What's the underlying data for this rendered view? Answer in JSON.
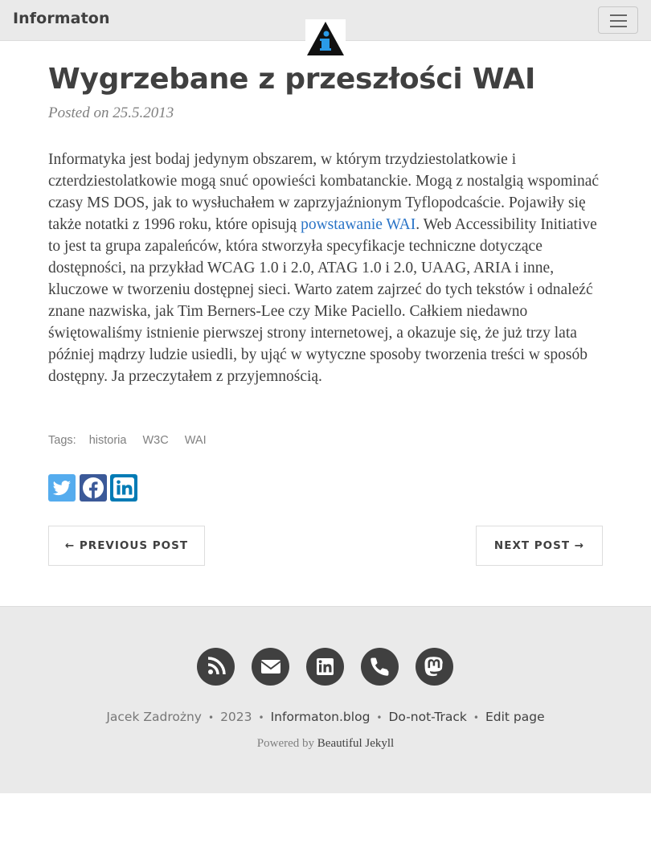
{
  "nav": {
    "brand": "Informaton",
    "logo_icon": "info-triangle-logo",
    "menu_icon": "hamburger-menu-icon"
  },
  "post": {
    "title": "Wygrzebane z przeszłości WAI",
    "meta": "Posted on 25.5.2013",
    "body_before_link": "Informatyka jest bodaj jedynym obszarem, w którym trzydziestolatkowie i czterdziestolatkowie mogą snuć opowieści kombatanckie. Mogą z nostalgią wspominać czasy MS DOS, jak to wysłuchałem w zaprzyjaźnionym Tyflopodcaście. Pojawiły się także notatki z 1996 roku, które opisują ",
    "link_text": "powstawanie WAI",
    "body_after_link": ". Web Accessibility Initiative to jest ta grupa zapaleńców, która stworzyła specyfikacje techniczne dotyczące dostępności, na przykład WCAG 1.0 i 2.0, ATAG 1.0 i 2.0, UAAG, ARIA i inne, kluczowe w tworzeniu dostępnej sieci. Warto zatem zajrzeć do tych tekstów i odnaleźć znane nazwiska, jak Tim Berners-Lee czy Mike Paciello. Całkiem niedawno świętowaliśmy istnienie pierwszej strony internetowej, a okazuje się, że już trzy lata później mądrzy ludzie usiedli, by ująć w wytyczne sposoby tworzenia treści w sposób dostępny. Ja przeczytałem z przyjemnością.",
    "link_color": "#2a74c7"
  },
  "tags": {
    "label": "Tags:",
    "items": [
      "historia",
      "W3C",
      "WAI"
    ]
  },
  "share": [
    {
      "name": "twitter",
      "icon": "twitter-icon",
      "color": "#55acee"
    },
    {
      "name": "facebook",
      "icon": "facebook-icon",
      "color": "#3b5998"
    },
    {
      "name": "linkedin",
      "icon": "linkedin-icon",
      "color": "#007bb5"
    }
  ],
  "pager": {
    "previous": "← PREVIOUS POST",
    "next": "NEXT POST →"
  },
  "footer": {
    "social_icons": [
      "rss-icon",
      "envelope-icon",
      "linkedin-icon",
      "phone-icon",
      "mastodon-icon"
    ],
    "author": "Jacek Zadrożny",
    "year": "2023",
    "site": "Informaton.blog",
    "dnt": "Do-not-Track",
    "edit": "Edit page",
    "powered_prefix": "Powered by",
    "powered_theme": "Beautiful Jekyll",
    "separator": "•"
  }
}
